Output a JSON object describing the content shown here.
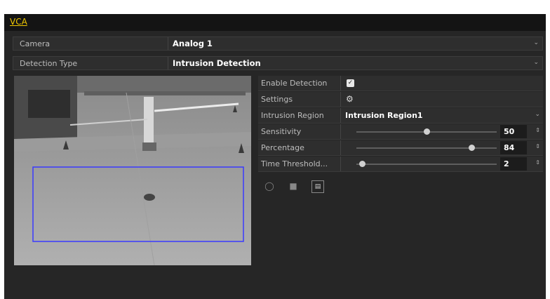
{
  "window": {
    "tab": "VCA"
  },
  "camera": {
    "label": "Camera",
    "value": "Analog 1"
  },
  "detection_type": {
    "label": "Detection Type",
    "value": "Intrusion Detection"
  },
  "settings": {
    "enable_detection": {
      "label": "Enable Detection",
      "checked": true
    },
    "settings_row": {
      "label": "Settings"
    },
    "intrusion_region": {
      "label": "Intrusion Region",
      "value": "Intrusion Region1"
    },
    "sensitivity": {
      "label": "Sensitivity",
      "value": "50",
      "level": 50
    },
    "percentage": {
      "label": "Percentage",
      "value": "84",
      "level": 84
    },
    "time_threshold": {
      "label": "Time Threshold...",
      "value": "2",
      "level": 2
    }
  },
  "icons": [
    "gear-icon",
    "dropdown-arrow-icon",
    "spin-icon",
    "draw-icon",
    "clear-icon",
    "region-icon"
  ],
  "colors": {
    "tab_accent": "#f0c800",
    "region_box": "#3a3aff",
    "background": "#262626"
  }
}
